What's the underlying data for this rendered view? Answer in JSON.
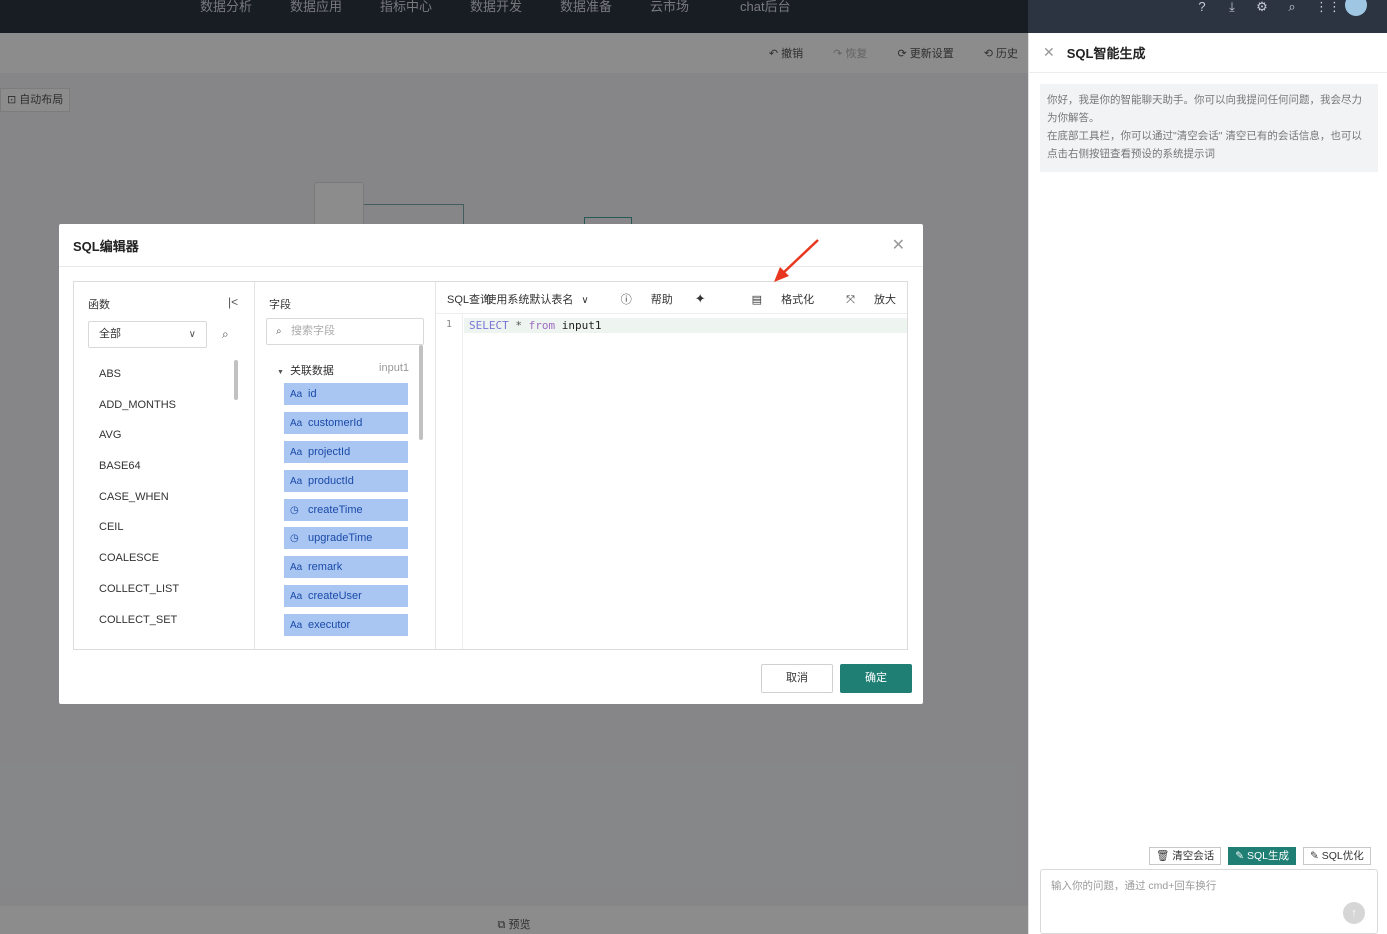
{
  "topnav": [
    "数据分析",
    "数据应用",
    "指标中心",
    "数据开发",
    "数据准备",
    "云市场",
    "chat后台"
  ],
  "canvas_toolbar": {
    "undo": "撤销",
    "redo": "恢复",
    "refresh": "更新设置",
    "history": "历史"
  },
  "auto_layout": "自动布局",
  "preview_label": "预览",
  "modal": {
    "title": "SQL编辑器",
    "functions": {
      "title": "函数",
      "category": "全部",
      "items": [
        "ABS",
        "ADD_MONTHS",
        "AVG",
        "BASE64",
        "CASE_WHEN",
        "CEIL",
        "COALESCE",
        "COLLECT_LIST",
        "COLLECT_SET"
      ]
    },
    "fields": {
      "title": "字段",
      "search_placeholder": "搜索字段",
      "group_name": "关联数据",
      "group_alias": "input1",
      "items": [
        {
          "icon": "Aa",
          "name": "id"
        },
        {
          "icon": "clock-icon",
          "name": "customerId"
        },
        {
          "icon": "Aa",
          "name": "projectId"
        },
        {
          "icon": "Aa",
          "name": "productId"
        },
        {
          "icon": "clock-icon",
          "name": "createTime"
        },
        {
          "icon": "clock-icon",
          "name": "upgradeTime"
        },
        {
          "icon": "Aa",
          "name": "remark"
        },
        {
          "icon": "Aa",
          "name": "createUser"
        },
        {
          "icon": "Aa",
          "name": "executor"
        }
      ]
    },
    "sql": {
      "title": "SQL查询",
      "alias_option": "使用系统默认表名",
      "help": "帮助",
      "format": "格式化",
      "zoom": "放大",
      "line_number": "1",
      "code": {
        "kw1": "SELECT",
        "op": "*",
        "kw2": "from",
        "table": "input1"
      }
    },
    "cancel": "取消",
    "ok": "确定"
  },
  "side_panel": {
    "title": "SQL智能生成",
    "greeting_1": "你好，我是你的智能聊天助手。你可以向我提问任何问题，我会尽力为你解答。",
    "greeting_2": "在底部工具栏，你可以通过\"清空会话\" 清空已有的会话信息，也可以点击右侧按钮查看预设的系统提示词",
    "btn_clear": "清空会话",
    "btn_generate": "SQL生成",
    "btn_optimize": "SQL优化",
    "input_placeholder": "输入你的问题，通过 cmd+回车换行"
  },
  "colors": {
    "accent": "#1f7f74",
    "field_chip": "#a9c6f2",
    "arrow": "#e8371e"
  }
}
